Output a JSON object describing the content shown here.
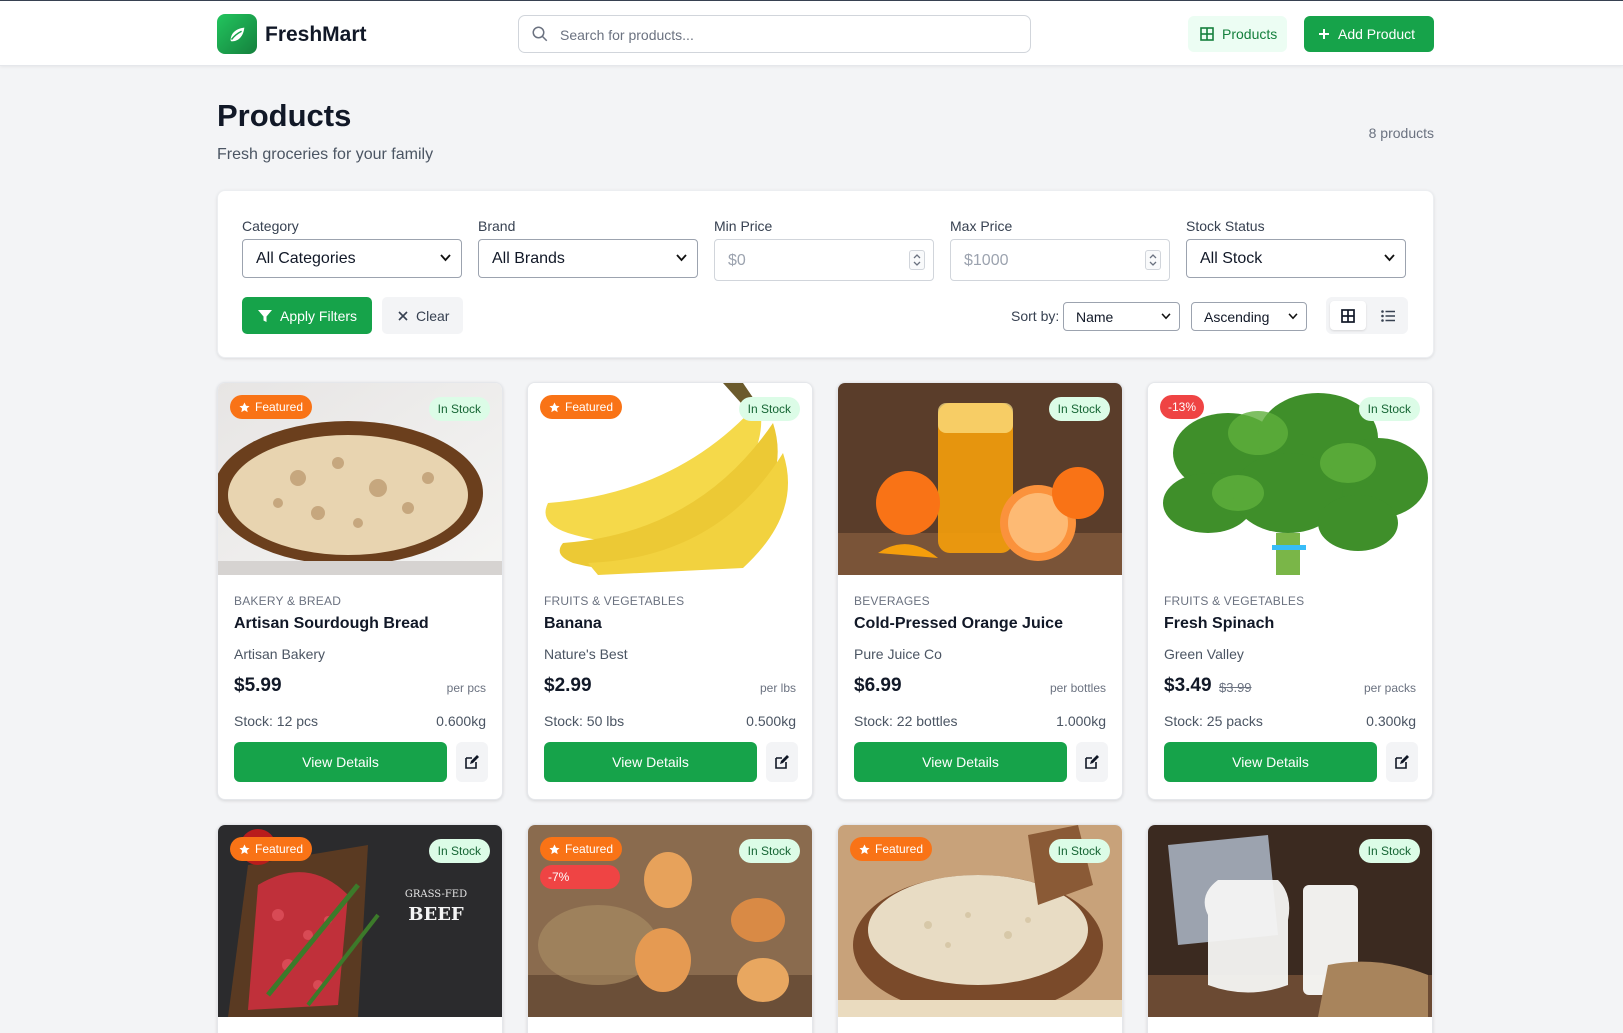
{
  "header": {
    "brand": "FreshMart",
    "search_placeholder": "Search for products...",
    "nav_products": "Products",
    "add_product": "Add Product"
  },
  "page": {
    "title": "Products",
    "subtitle": "Fresh groceries for your family",
    "count": "8 products"
  },
  "filters": {
    "category_label": "Category",
    "category_value": "All Categories",
    "brand_label": "Brand",
    "brand_value": "All Brands",
    "min_price_label": "Min Price",
    "min_price_placeholder": "$0",
    "max_price_label": "Max Price",
    "max_price_placeholder": "$1000",
    "stock_label": "Stock Status",
    "stock_value": "All Stock",
    "apply": "Apply Filters",
    "clear": "Clear",
    "sort_label": "Sort by:",
    "sort_field": "Name",
    "sort_order": "Ascending"
  },
  "products": [
    {
      "category": "BAKERY & BREAD",
      "name": "Artisan Sourdough Bread",
      "brand": "Artisan Bakery",
      "price": "$5.99",
      "old_price": "",
      "unit": "per pcs",
      "stock": "Stock: 12 pcs",
      "weight": "0.600kg",
      "featured": "Featured",
      "stock_badge": "In Stock",
      "discount": "",
      "view": "View Details"
    },
    {
      "category": "FRUITS & VEGETABLES",
      "name": "Banana",
      "brand": "Nature's Best",
      "price": "$2.99",
      "old_price": "",
      "unit": "per lbs",
      "stock": "Stock: 50 lbs",
      "weight": "0.500kg",
      "featured": "Featured",
      "stock_badge": "In Stock",
      "discount": "",
      "view": "View Details"
    },
    {
      "category": "BEVERAGES",
      "name": "Cold-Pressed Orange Juice",
      "brand": "Pure Juice Co",
      "price": "$6.99",
      "old_price": "",
      "unit": "per bottles",
      "stock": "Stock: 22 bottles",
      "weight": "1.000kg",
      "featured": "",
      "stock_badge": "In Stock",
      "discount": "",
      "view": "View Details"
    },
    {
      "category": "FRUITS & VEGETABLES",
      "name": "Fresh Spinach",
      "brand": "Green Valley",
      "price": "$3.49",
      "old_price": "$3.99",
      "unit": "per packs",
      "stock": "Stock: 25 packs",
      "weight": "0.300kg",
      "featured": "",
      "stock_badge": "In Stock",
      "discount": "-13%",
      "view": "View Details"
    },
    {
      "featured": "Featured",
      "stock_badge": "In Stock",
      "discount": ""
    },
    {
      "featured": "Featured",
      "stock_badge": "In Stock",
      "discount": "-7%"
    },
    {
      "featured": "Featured",
      "stock_badge": "In Stock",
      "discount": ""
    },
    {
      "featured": "",
      "stock_badge": "In Stock",
      "discount": ""
    }
  ],
  "beef_logo_text": "GRASS-FED BEEF",
  "colors": {
    "primary": "#16a34a",
    "featured": "#f97316",
    "discount": "#ef4444",
    "stock_bg": "#dcfce7"
  }
}
